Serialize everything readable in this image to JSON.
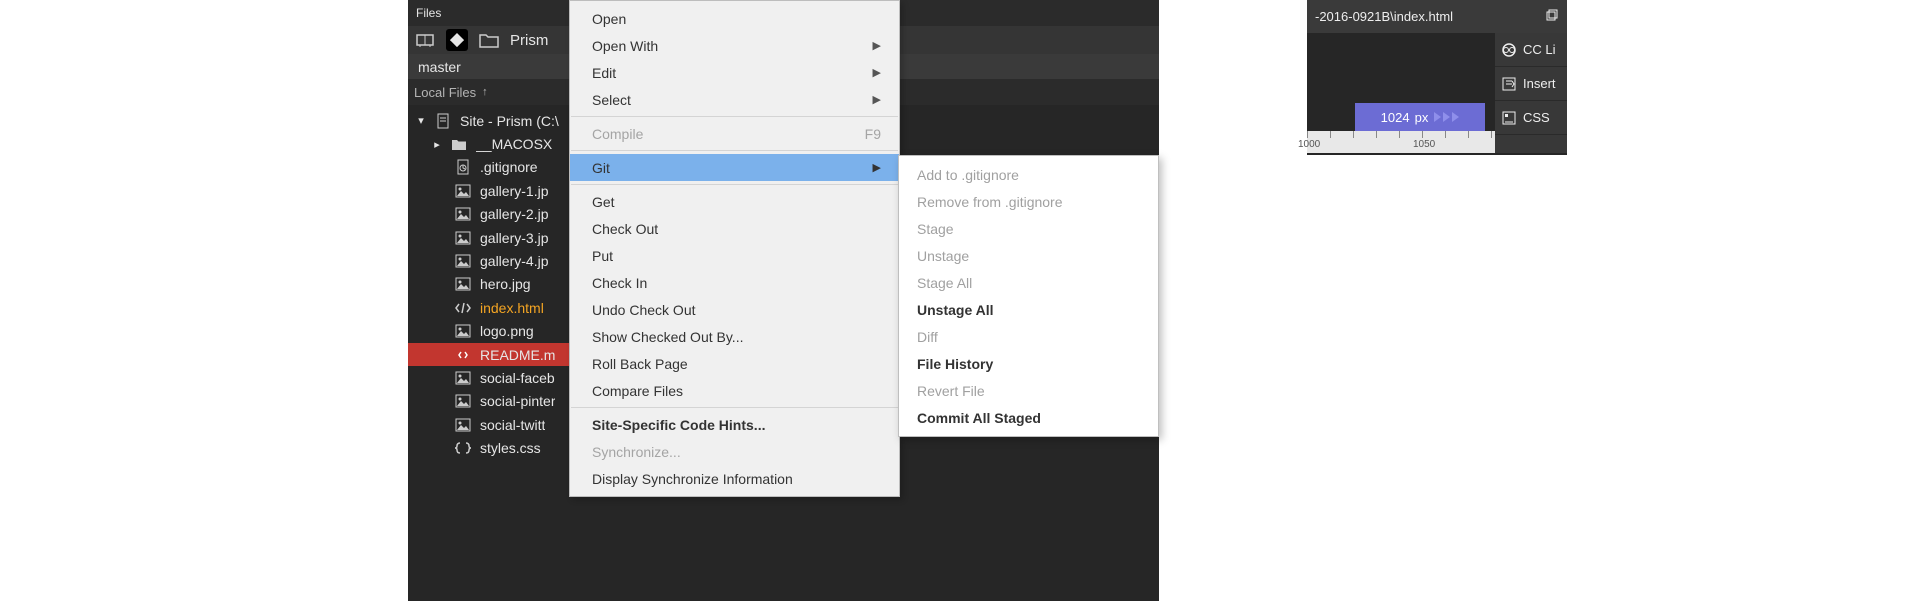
{
  "files_panel": {
    "title": "Files",
    "site_name": "Prism",
    "branch": "master",
    "local_files_label": "Local Files",
    "tree": {
      "root": {
        "label": "Site - Prism (C:\\"
      },
      "items": [
        {
          "label": "__MACOSX",
          "type": "folder",
          "expanded": false,
          "depth": 1
        },
        {
          "label": ".gitignore",
          "type": "gitignore",
          "depth": 2
        },
        {
          "label": "gallery-1.jp",
          "type": "image",
          "depth": 2
        },
        {
          "label": "gallery-2.jp",
          "type": "image",
          "depth": 2
        },
        {
          "label": "gallery-3.jp",
          "type": "image",
          "depth": 2
        },
        {
          "label": "gallery-4.jp",
          "type": "image",
          "depth": 2
        },
        {
          "label": "hero.jpg",
          "type": "image",
          "depth": 2
        },
        {
          "label": "index.html",
          "type": "html",
          "depth": 2,
          "highlight": true
        },
        {
          "label": "logo.png",
          "type": "image",
          "depth": 2
        },
        {
          "label": "README.m",
          "type": "readme",
          "depth": 2,
          "selected": true
        },
        {
          "label": "social-faceb",
          "type": "image",
          "depth": 2
        },
        {
          "label": "social-pinter",
          "type": "image",
          "depth": 2
        },
        {
          "label": "social-twitt",
          "type": "image",
          "depth": 2
        },
        {
          "label": "styles.css",
          "type": "css",
          "depth": 2
        }
      ]
    }
  },
  "context_menu": {
    "items": [
      {
        "label": "Open",
        "type": "item"
      },
      {
        "label": "Open With",
        "type": "submenu"
      },
      {
        "label": "Edit",
        "type": "submenu"
      },
      {
        "label": "Select",
        "type": "submenu"
      },
      {
        "type": "sep"
      },
      {
        "label": "Compile",
        "shortcut": "F9",
        "disabled": true,
        "type": "item"
      },
      {
        "type": "sep"
      },
      {
        "label": "Git",
        "type": "submenu",
        "highlighted": true
      },
      {
        "type": "sep"
      },
      {
        "label": "Get",
        "type": "item"
      },
      {
        "label": "Check Out",
        "type": "item"
      },
      {
        "label": "Put",
        "type": "item"
      },
      {
        "label": "Check In",
        "type": "item"
      },
      {
        "label": "Undo Check Out",
        "type": "item"
      },
      {
        "label": "Show Checked Out By...",
        "type": "item"
      },
      {
        "label": "Roll Back Page",
        "type": "item"
      },
      {
        "label": "Compare Files",
        "type": "item"
      },
      {
        "type": "sep"
      },
      {
        "label": "Site-Specific Code Hints...",
        "bold": true,
        "type": "item"
      },
      {
        "label": "Synchronize...",
        "disabled": true,
        "type": "item"
      },
      {
        "label": "Display Synchronize Information",
        "type": "item"
      }
    ]
  },
  "git_submenu": {
    "items": [
      {
        "label": "Add to .gitignore",
        "disabled": true
      },
      {
        "label": "Remove from .gitignore",
        "disabled": true
      },
      {
        "label": "Stage",
        "disabled": true
      },
      {
        "label": "Unstage",
        "disabled": true
      },
      {
        "label": "Stage All",
        "disabled": true
      },
      {
        "label": "Unstage All",
        "bold": true
      },
      {
        "label": "Diff",
        "disabled": true
      },
      {
        "label": "File History",
        "bold": true
      },
      {
        "label": "Revert File",
        "disabled": true
      },
      {
        "label": "Commit All Staged",
        "bold": true
      }
    ]
  },
  "doc": {
    "tab": "-2016-0921B\\index.html",
    "ruler_value": "1024",
    "ruler_unit": "px",
    "ticks": [
      "1000",
      "1050"
    ]
  },
  "right_panel": {
    "items": [
      "CC Li",
      "Insert",
      "CSS "
    ]
  }
}
